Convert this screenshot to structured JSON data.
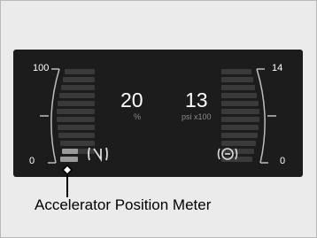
{
  "gauges": {
    "left": {
      "max_label": "100",
      "min_label": "0"
    },
    "right": {
      "max_label": "14",
      "min_label": "0"
    }
  },
  "readouts": {
    "accelerator": {
      "value": "20",
      "unit": "%"
    },
    "boost": {
      "value": "13",
      "unit": "psi x100"
    }
  },
  "icons": {
    "left": "accelerator-icon",
    "right": "brake-icon"
  },
  "callout": {
    "label": "Accelerator Position Meter"
  },
  "colors": {
    "panel": "#1c1c1c",
    "text": "#ffffff",
    "unit_text": "#8c8c8c",
    "bars": "#3c3c3c",
    "arc": "#bcbcbc"
  }
}
